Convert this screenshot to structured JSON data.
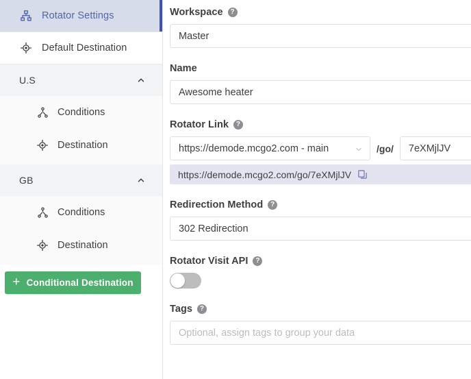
{
  "sidebar": {
    "top_items": [
      {
        "label": "Rotator Settings",
        "icon": "sitemap-icon",
        "active": true
      },
      {
        "label": "Default Destination",
        "icon": "target-icon",
        "active": false
      }
    ],
    "groups": [
      {
        "title": "U.S",
        "expanded": true,
        "items": [
          {
            "label": "Conditions",
            "icon": "node-branch-icon"
          },
          {
            "label": "Destination",
            "icon": "target-icon"
          }
        ]
      },
      {
        "title": "GB",
        "expanded": true,
        "items": [
          {
            "label": "Conditions",
            "icon": "node-branch-icon"
          },
          {
            "label": "Destination",
            "icon": "target-icon"
          }
        ]
      }
    ],
    "add_button": {
      "plus": "+",
      "label": "Conditional Destination",
      "color": "#4caf6d"
    }
  },
  "form": {
    "workspace": {
      "label": "Workspace",
      "help": "?",
      "value": "Master"
    },
    "name": {
      "label": "Name",
      "value": "Awesome heater"
    },
    "rotator_link": {
      "label": "Rotator Link",
      "help": "?",
      "domain_value": "https://demode.mcgo2.com - main",
      "separator": "/go/",
      "slug_value": "7eXMjlJV",
      "generated_url": "https://demode.mcgo2.com/go/7eXMjlJV",
      "copy_icon": "copy-icon"
    },
    "redirection_method": {
      "label": "Redirection Method",
      "help": "?",
      "value": "302 Redirection"
    },
    "rotator_visit_api": {
      "label": "Rotator Visit API",
      "help": "?",
      "enabled": false
    },
    "tags": {
      "label": "Tags",
      "help": "?",
      "value": "",
      "placeholder": "Optional, assign tags to group your data"
    }
  },
  "colors": {
    "accent_blue": "#3f51b5",
    "active_bg": "#d6dcea",
    "green": "#4caf6d",
    "copy_bar_bg": "#e4e4f0"
  }
}
